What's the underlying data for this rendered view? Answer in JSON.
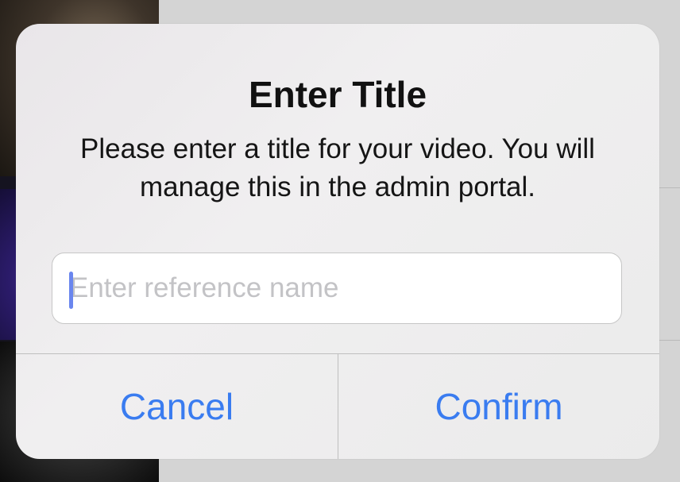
{
  "alert": {
    "title": "Enter Title",
    "message": "Please enter a title for your video. You will manage this in the admin portal.",
    "input": {
      "placeholder": "Enter reference name",
      "value": ""
    },
    "buttons": {
      "cancel": "Cancel",
      "confirm": "Confirm"
    }
  },
  "colors": {
    "button_text": "#3a7cf0",
    "caret": "#6a86ee",
    "alert_background": "#eeedee"
  }
}
